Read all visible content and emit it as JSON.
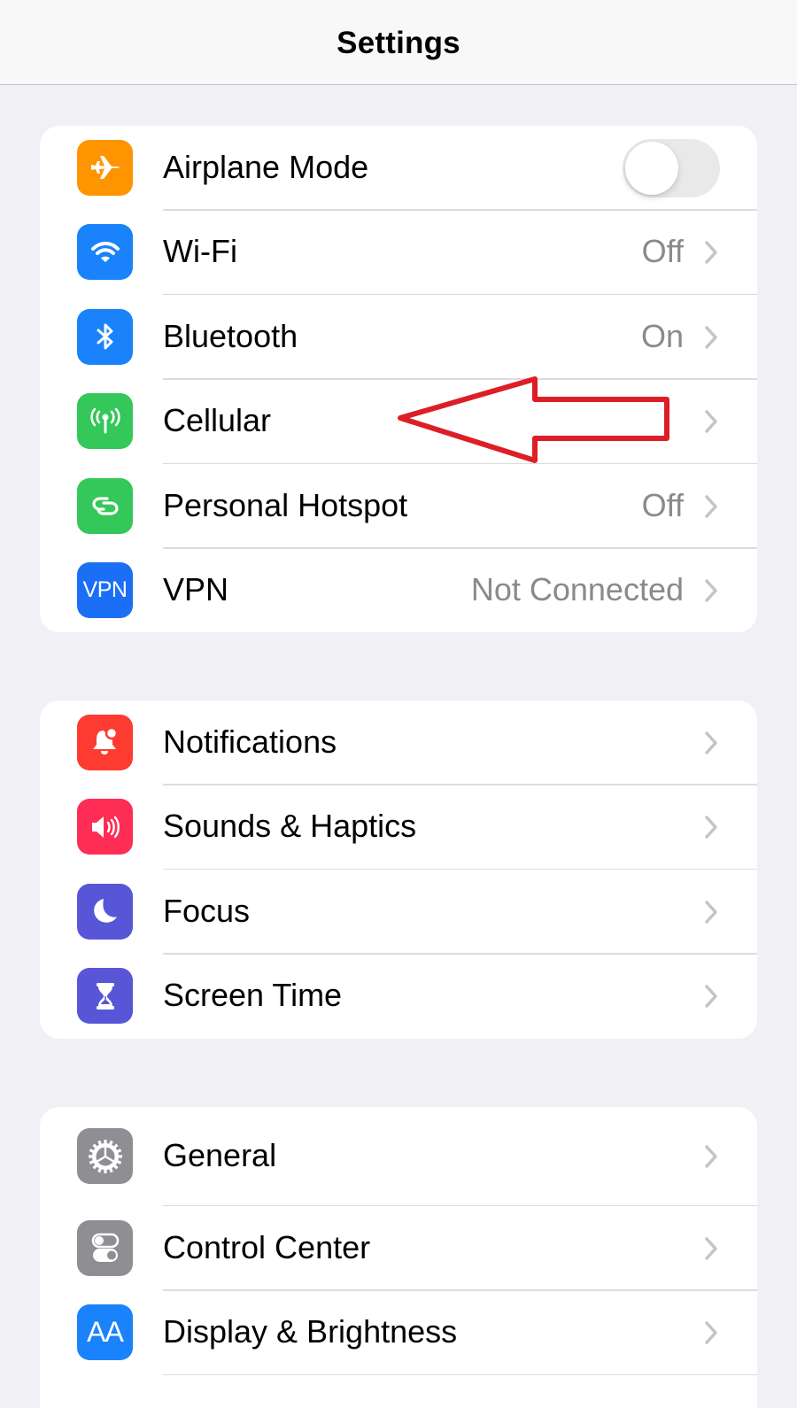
{
  "navbar": {
    "title": "Settings"
  },
  "groups": [
    {
      "items": [
        {
          "label": "Airplane Mode",
          "icon": "airplane-icon",
          "icon_color": "#fe9500",
          "control": "toggle",
          "toggle_on": false
        },
        {
          "label": "Wi-Fi",
          "icon": "wifi-icon",
          "icon_color": "#1a82fb",
          "value": "Off"
        },
        {
          "label": "Bluetooth",
          "icon": "bluetooth-icon",
          "icon_color": "#1a82fb",
          "value": "On"
        },
        {
          "label": "Cellular",
          "icon": "cellular-antenna-icon",
          "icon_color": "#34c759",
          "value": ""
        },
        {
          "label": "Personal Hotspot",
          "icon": "hotspot-link-icon",
          "icon_color": "#34c759",
          "value": "Off"
        },
        {
          "label": "VPN",
          "icon": "vpn-icon",
          "icon_text": "VPN",
          "icon_color": "#1a6ff5",
          "value": "Not Connected"
        }
      ]
    },
    {
      "items": [
        {
          "label": "Notifications",
          "icon": "bell-icon",
          "icon_color": "#fe3b30"
        },
        {
          "label": "Sounds & Haptics",
          "icon": "speaker-icon",
          "icon_color": "#fe2d55"
        },
        {
          "label": "Focus",
          "icon": "moon-icon",
          "icon_color": "#5856d6"
        },
        {
          "label": "Screen Time",
          "icon": "hourglass-icon",
          "icon_color": "#5856d6"
        }
      ]
    },
    {
      "items": [
        {
          "label": "General",
          "icon": "gear-icon",
          "icon_color": "#8e8e93"
        },
        {
          "label": "Control Center",
          "icon": "control-center-toggles-icon",
          "icon_color": "#8e8e93"
        },
        {
          "label": "Display & Brightness",
          "icon": "display-text-size-icon",
          "icon_text": "AA",
          "icon_color": "#1a82fb"
        }
      ]
    }
  ],
  "annotation": {
    "type": "arrow",
    "color": "#dc1f26",
    "points_to": "Cellular"
  },
  "colors": {
    "background": "#f0f0f5",
    "secondary_text": "#8a8a8e",
    "chevron": "#c4c4c7"
  }
}
